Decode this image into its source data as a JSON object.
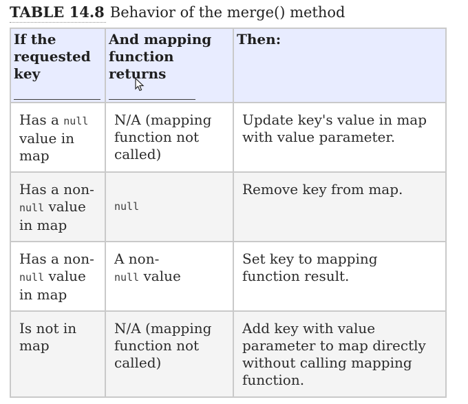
{
  "caption": {
    "label": "TABLE 14.8",
    "title": "Behavior of the merge() method"
  },
  "table": {
    "headers": [
      "If the requested key",
      "And mapping function returns",
      "Then:"
    ],
    "rows": [
      {
        "key_pre": "Has a ",
        "key_code": "null",
        "key_post": " value in map",
        "returns_text": "N/A (mapping function not called)",
        "then": "Update key's value in map with value parameter."
      },
      {
        "key_pre": "Has a non-",
        "key_code": "null",
        "key_post": " value in map",
        "returns_code": "null",
        "then": "Remove key from map."
      },
      {
        "key_pre": "Has a non-",
        "key_code": "null",
        "key_post": " value in map",
        "returns_pre": "A non-",
        "returns_code": "null",
        "returns_post": " value",
        "then": "Set key to mapping function result."
      },
      {
        "key_text": "Is not in map",
        "returns_text": "N/A (mapping function not called)",
        "then": "Add key with value parameter to map directly without calling mapping function."
      }
    ]
  }
}
